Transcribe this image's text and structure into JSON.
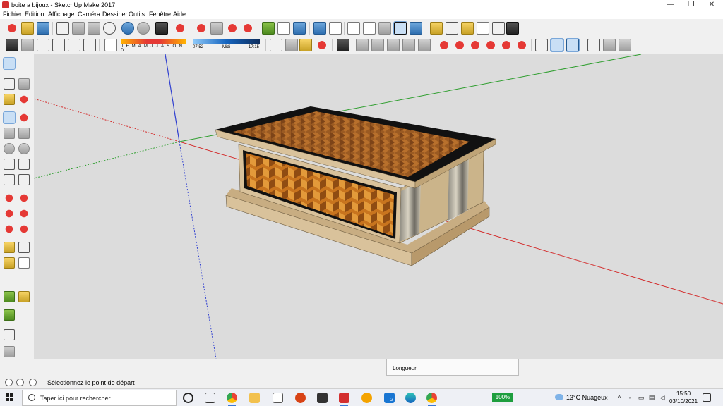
{
  "window": {
    "title": "boite a bijoux - SketchUp Make 2017",
    "controls": {
      "minimize": "—",
      "maximize": "❐",
      "close": "✕"
    }
  },
  "menu": [
    "Fichier",
    "Édition",
    "Affichage",
    "Caméra",
    "Dessiner",
    "Outils",
    "Fenêtre",
    "Aide"
  ],
  "shadow_settings": {
    "months_label": "J F M A M J J A S O N D",
    "time_start": "07:52",
    "time_mid": "Midi",
    "time_end": "17:15"
  },
  "status": {
    "message": "Sélectionnez le point de départ",
    "measurements_label": "Longueur"
  },
  "taskbar": {
    "search_placeholder": "Taper ici pour rechercher",
    "battery": "100%",
    "weather": "13°C  Nuageux",
    "mail_badge": "2",
    "time": "15:50",
    "date": "03/10/2021"
  },
  "colors": {
    "viewport_bg": "#dcdcdc",
    "axis_red": "#d32f2f",
    "axis_green": "#2e9e2e",
    "axis_blue": "#2f3fd0",
    "wood_light": "#d9c29b",
    "wood_dark_trim": "#1a1a1a",
    "inlay_orange": "#c8741e"
  },
  "icons": {
    "toolbar_top": [
      "new-file-icon",
      "open-icon",
      "save-icon",
      "cut-icon",
      "copy-icon",
      "paste-icon",
      "erase-icon",
      "undo-icon",
      "redo-icon",
      "print-icon",
      "model-info-icon",
      "select-icon",
      "component-icon",
      "paint-bucket-icon",
      "eraser-icon",
      "iso-view-icon",
      "top-view-icon",
      "front-view-icon",
      "right-view-icon",
      "back-view-icon",
      "left-view-icon",
      "xray-icon",
      "wireframe-icon",
      "hidden-line-icon",
      "shaded-icon",
      "shaded-textures-icon",
      "monochrome-icon",
      "tape-measure-icon",
      "dimension-icon",
      "protractor-icon",
      "text-icon",
      "axes-icon",
      "3d-text-icon"
    ],
    "toolbar_left": [
      "pencil-icon",
      "select-arrow-icon",
      "make-component-icon",
      "paint-icon",
      "eraser-icon",
      "line-icon",
      "freehand-icon",
      "rectangle-icon",
      "rotated-rect-icon",
      "circle-icon",
      "polygon-icon",
      "arc-icon",
      "pie-icon",
      "move-icon",
      "pushpull-icon",
      "rotate-icon",
      "followme-icon",
      "scale-icon",
      "offset-icon",
      "tape-icon",
      "dimension-icon",
      "protractor-icon",
      "text-icon",
      "orbit-icon",
      "pan-icon",
      "walk-icon",
      "look-around-icon",
      "section-icon"
    ]
  }
}
